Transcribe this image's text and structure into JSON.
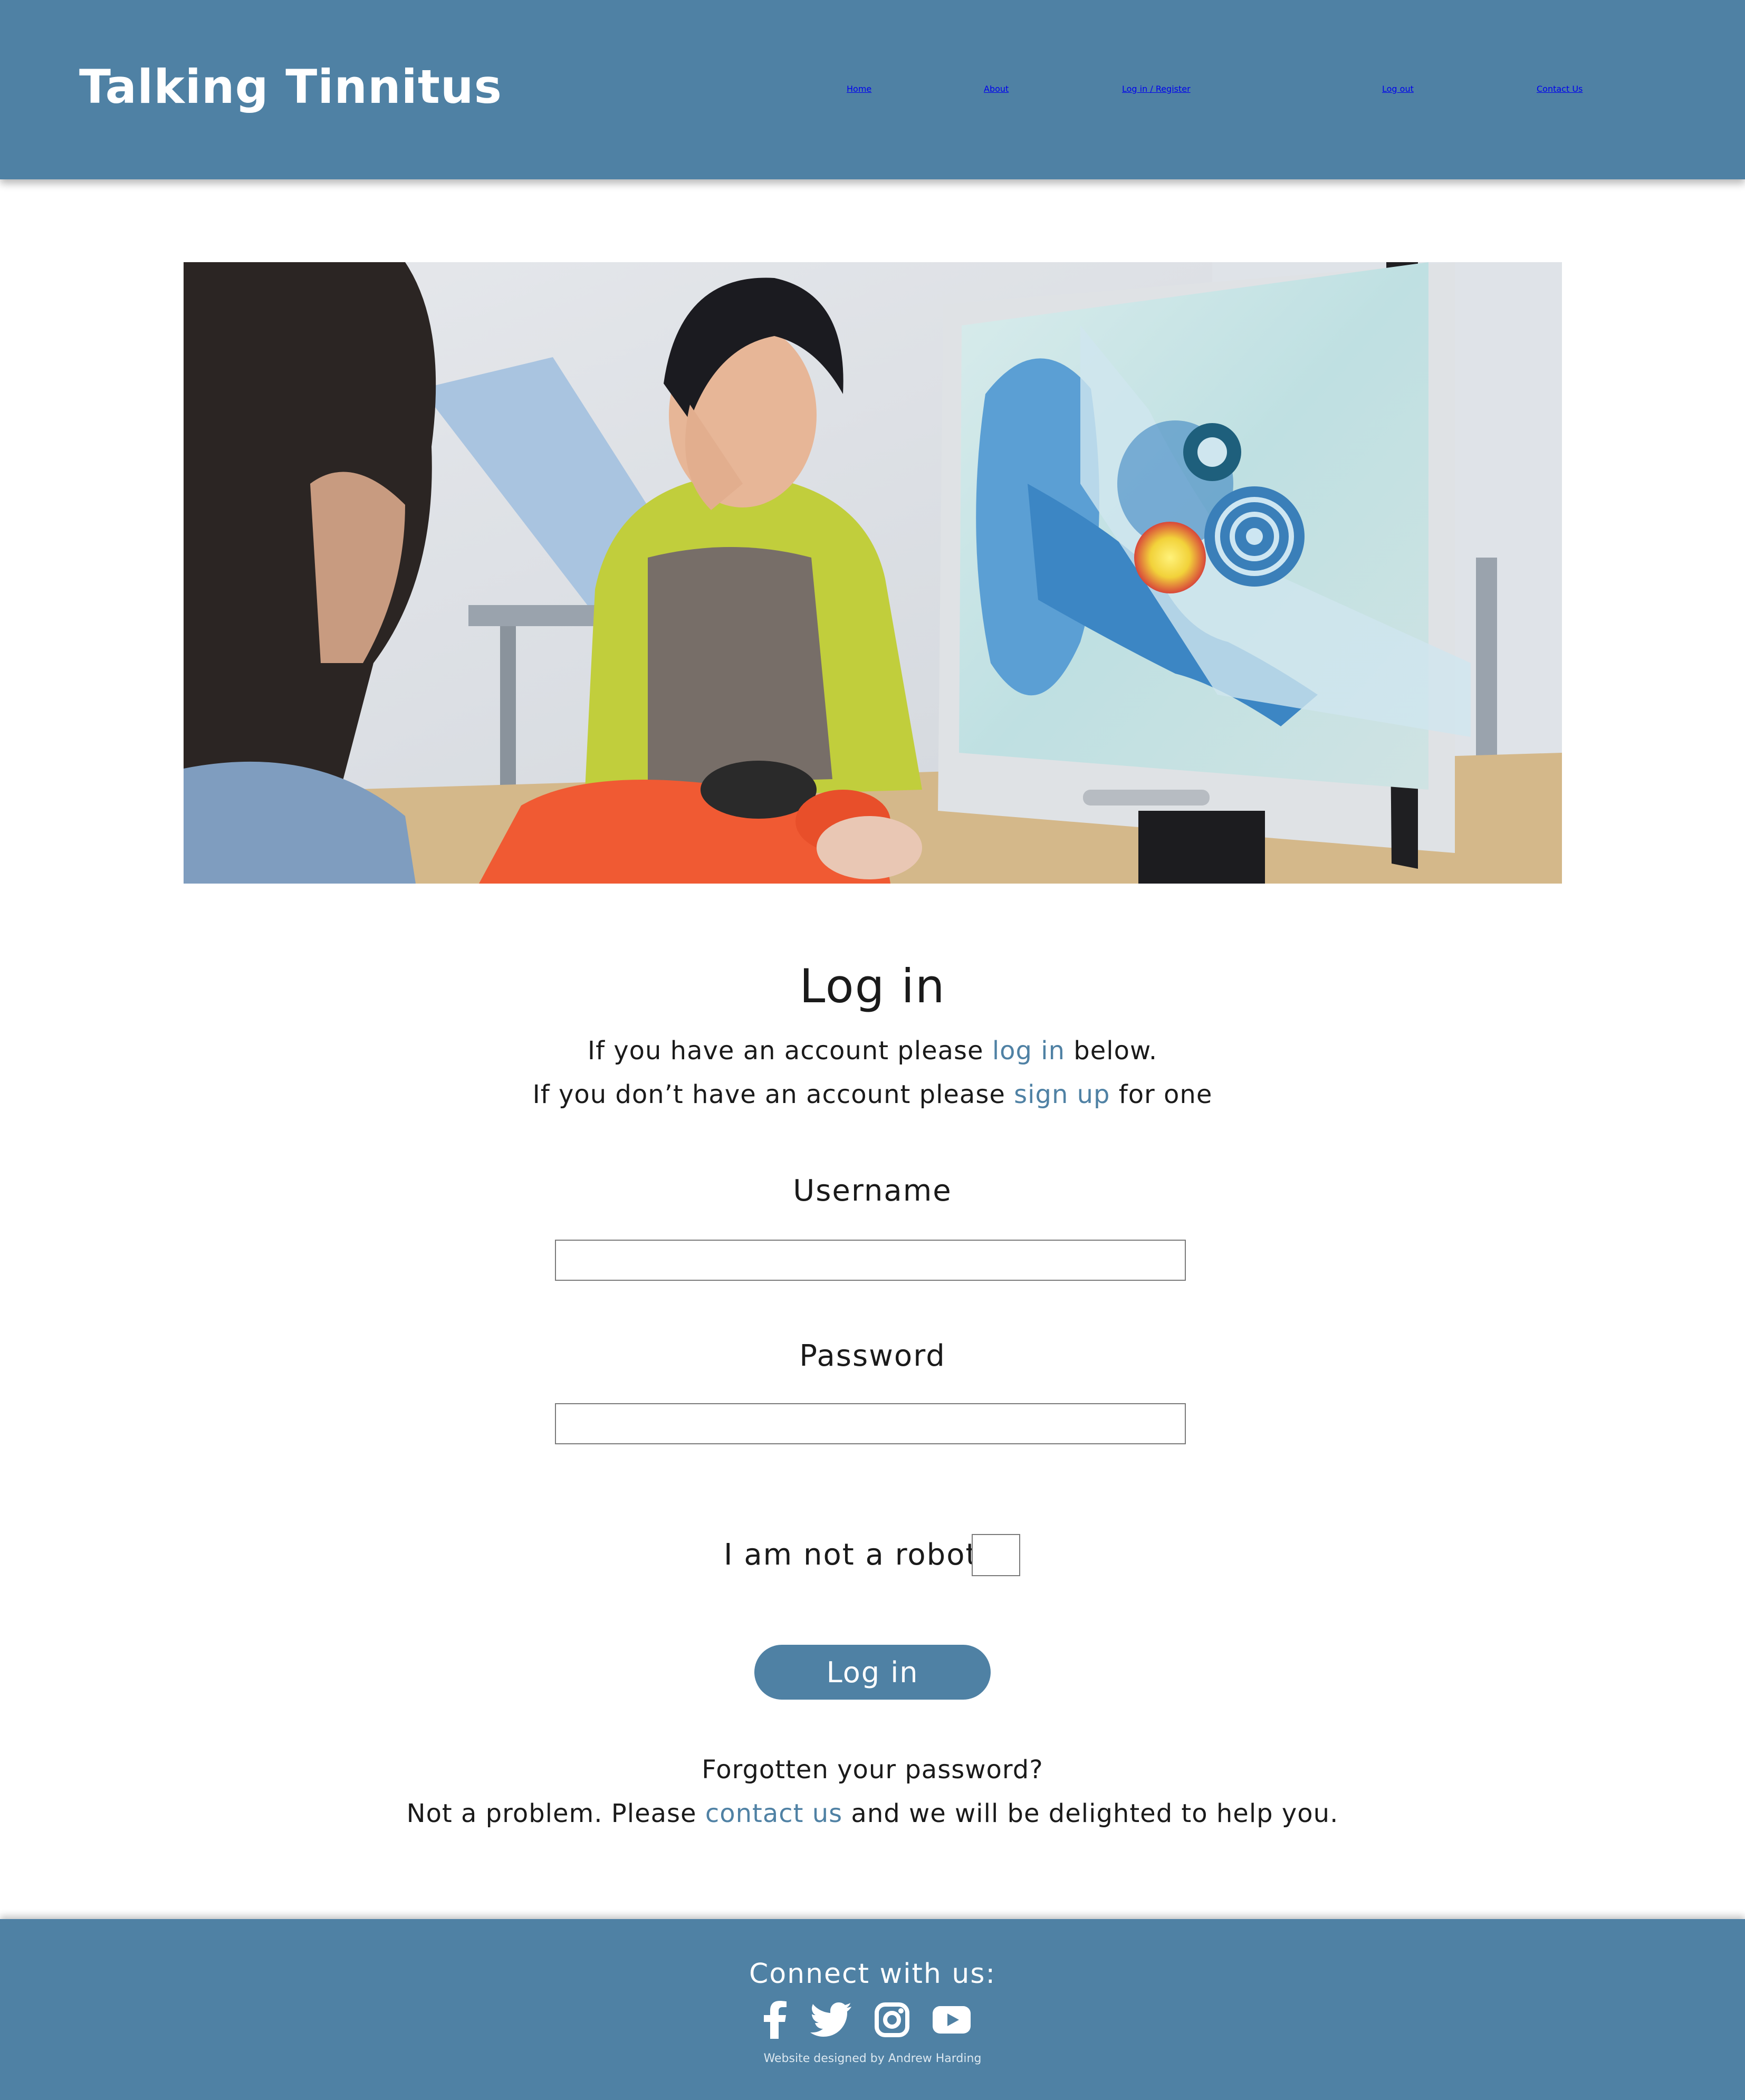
{
  "header": {
    "brand": "Talking Tinnitus",
    "nav": [
      "Home",
      "About",
      "Log in / Register",
      "Log out",
      "Contact Us"
    ]
  },
  "login": {
    "title": "Log in",
    "intro_line1": {
      "before": "If you have an account please ",
      "link": "log in",
      "after": " below."
    },
    "intro_line2": {
      "before": "If you don’t have an account please ",
      "link": "sign up",
      "after": " for one"
    },
    "username_label": "Username",
    "username_value": "",
    "password_label": "Password",
    "password_value": "",
    "robot_label": "I am not a robot",
    "robot_checked": false,
    "button_label": "Log in",
    "forgot_line1": "Forgotten your password?",
    "forgot_line2": {
      "before": "Not a problem. Please ",
      "link": "contact us",
      "after": " and we will be delighted to help you."
    }
  },
  "footer": {
    "connect": "Connect with us:",
    "social_icons": [
      "facebook-icon",
      "twitter-icon",
      "instagram-icon",
      "youtube-icon"
    ],
    "credit": "Website designed by Andrew Harding"
  },
  "colors": {
    "brand_blue": "#4f81a4",
    "text": "#1a1a1a",
    "background": "#ffffff"
  }
}
